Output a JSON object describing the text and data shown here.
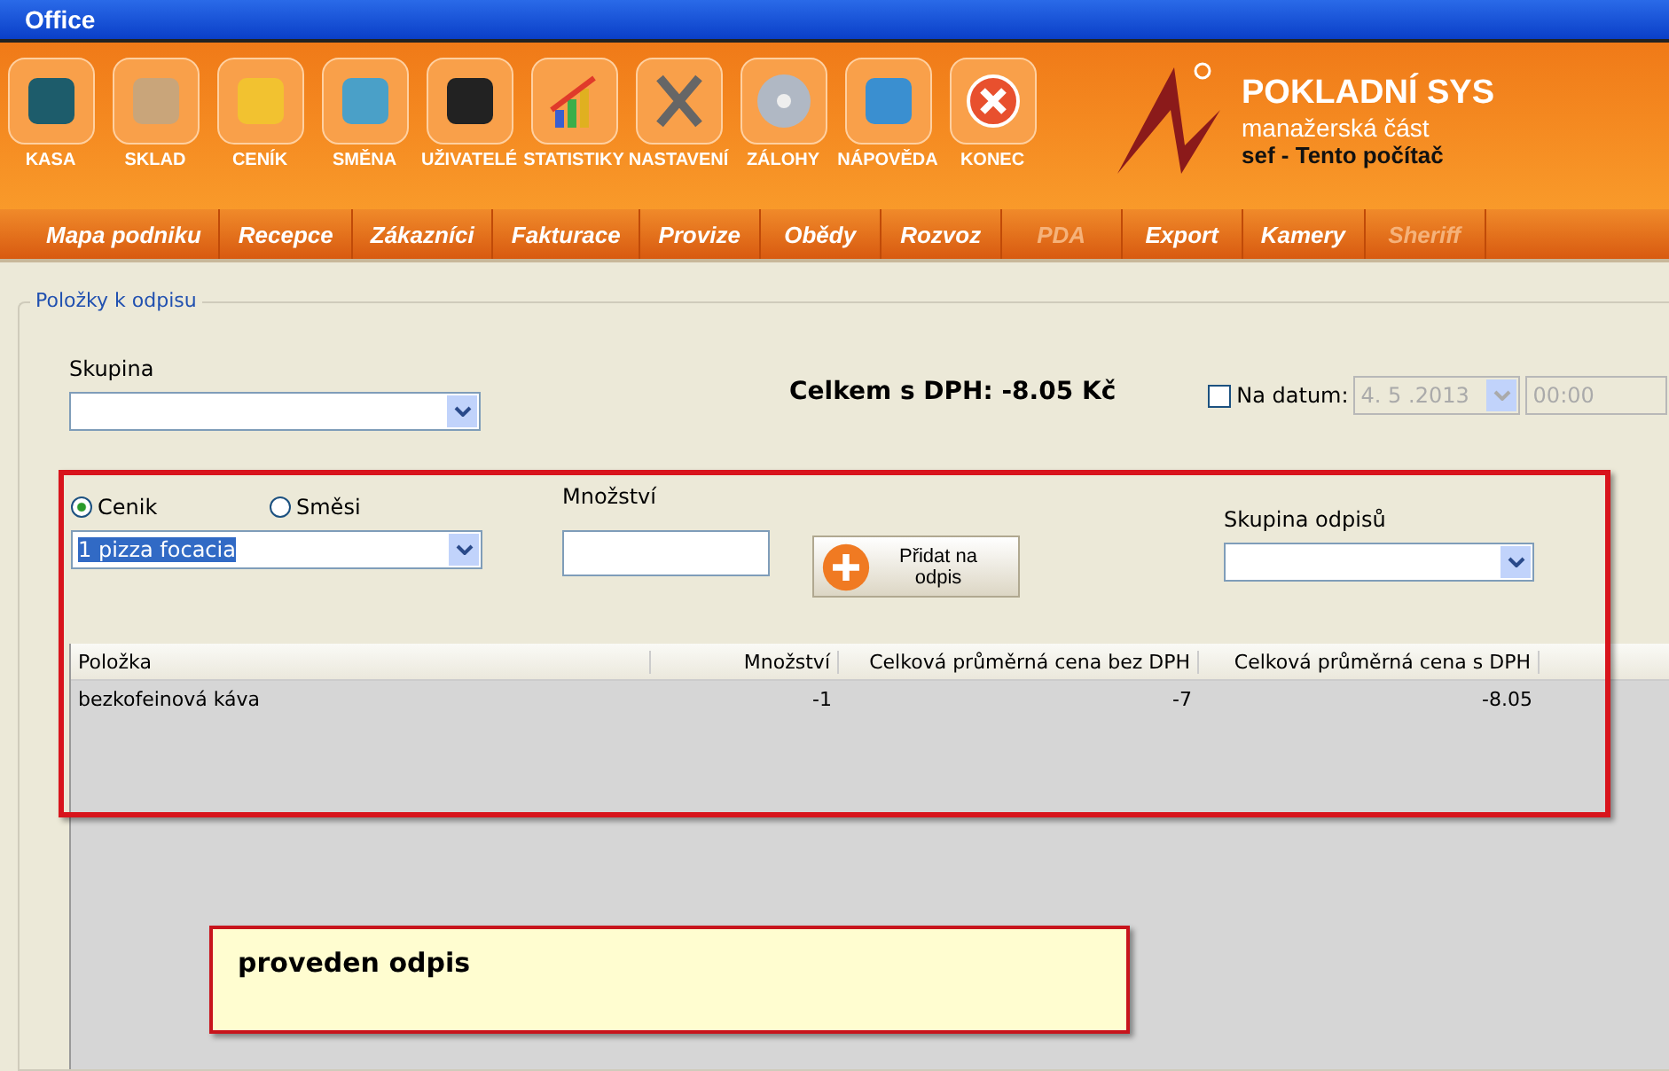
{
  "window": {
    "title": "Office"
  },
  "toolbar": [
    {
      "label": "KASA"
    },
    {
      "label": "SKLAD"
    },
    {
      "label": "CENÍK"
    },
    {
      "label": "SMĚNA"
    },
    {
      "label": "UŽIVATELÉ"
    },
    {
      "label": "STATISTIKY"
    },
    {
      "label": "NASTAVENÍ"
    },
    {
      "label": "ZÁLOHY"
    },
    {
      "label": "NÁPOVĚDA"
    },
    {
      "label": "KONEC"
    }
  ],
  "brand": {
    "title": "POKLADNÍ SYS",
    "subtitle": "manažerská část",
    "user": "sef  -  Tento počítač"
  },
  "nav": [
    {
      "label": "Mapa podniku",
      "disabled": false
    },
    {
      "label": "Recepce",
      "disabled": false
    },
    {
      "label": "Zákazníci",
      "disabled": false
    },
    {
      "label": "Fakturace",
      "disabled": false
    },
    {
      "label": "Provize",
      "disabled": false
    },
    {
      "label": "Obědy",
      "disabled": false
    },
    {
      "label": "Rozvoz",
      "disabled": false
    },
    {
      "label": "PDA",
      "disabled": true
    },
    {
      "label": "Export",
      "disabled": false
    },
    {
      "label": "Kamery",
      "disabled": false
    },
    {
      "label": "Sheriff",
      "disabled": true
    }
  ],
  "group": {
    "title": "Položky k odpisu"
  },
  "skupina": {
    "label": "Skupina"
  },
  "total": "Celkem s DPH: -8.05 Kč",
  "date": {
    "label": "Na datum:",
    "checked": false,
    "date": "4. 5 .2013",
    "time": "00:00"
  },
  "sources": [
    {
      "label": "Cenik",
      "selected": true
    },
    {
      "label": "Směsi",
      "selected": false
    }
  ],
  "item_select": {
    "value": "1 pizza focacia"
  },
  "quantity": {
    "label": "Množství"
  },
  "add_button": {
    "label": "Přidat na odpis"
  },
  "write_off_group": {
    "label": "Skupina odpisů"
  },
  "table": {
    "columns": [
      "Položka",
      "Množství",
      "Celková průměrná cena bez DPH",
      "Celková průměrná cena s DPH"
    ],
    "rows": [
      [
        "bezkofeinová káva",
        "-1",
        "-7",
        "-8.05"
      ]
    ]
  },
  "callout": "proveden odpis"
}
